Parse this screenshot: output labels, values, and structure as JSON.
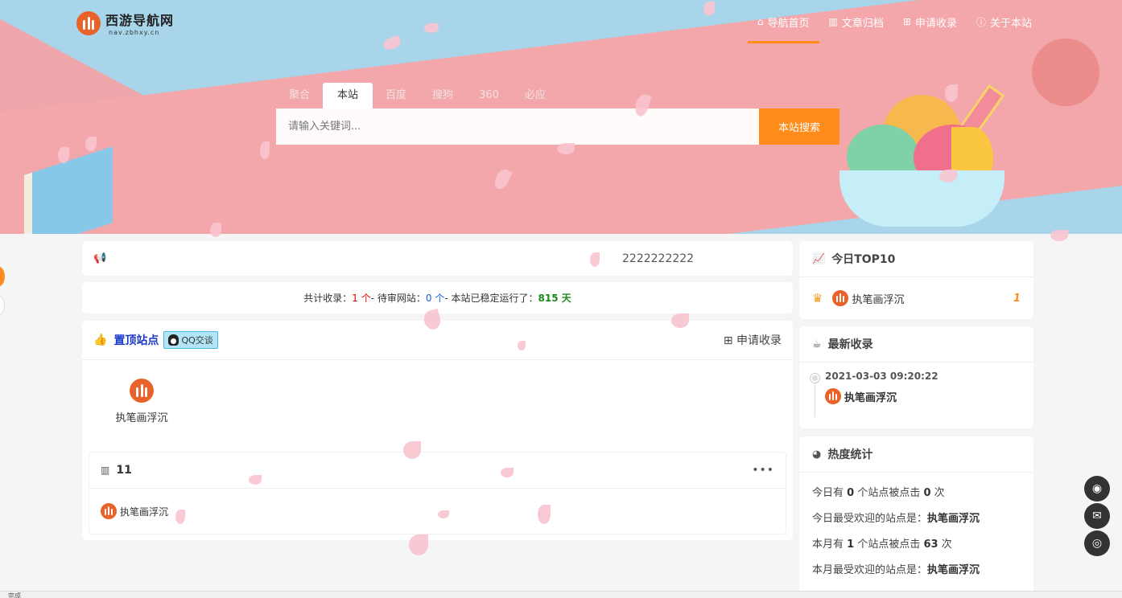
{
  "brand": {
    "name": "西游导航网",
    "url": "nav.zbhxy.cn"
  },
  "nav": [
    {
      "icon": "home-icon",
      "glyph": "⌂",
      "label": "导航首页",
      "active": true
    },
    {
      "icon": "bar-chart-icon",
      "glyph": "▥",
      "label": "文章归档"
    },
    {
      "icon": "plus-square-icon",
      "glyph": "⊞",
      "label": "申请收录"
    },
    {
      "icon": "info-icon",
      "glyph": "ⓘ",
      "label": "关于本站"
    }
  ],
  "search": {
    "tabs": [
      "聚合",
      "本站",
      "百度",
      "搜狗",
      "360",
      "必应"
    ],
    "active_tab": "本站",
    "placeholder": "请输入关键词...",
    "button": "本站搜索"
  },
  "notice": {
    "text": "2222222222"
  },
  "stats": {
    "label1": "共计收录：",
    "total": "1 个",
    "sep1": " - 待审网站：",
    "pending": "0 个",
    "sep2": " - 本站已稳定运行了：",
    "days": "815 天"
  },
  "top_sites": {
    "title": "置顶站点",
    "qq_label": "QQ交谈",
    "apply_label": "申请收录",
    "items": [
      {
        "label": "执笔画浮沉"
      }
    ]
  },
  "category": {
    "count": "11",
    "more": "•••",
    "items": [
      {
        "label": "执笔画浮沉"
      }
    ]
  },
  "top10": {
    "title": "今日TOP10",
    "items": [
      {
        "label": "执笔画浮沉",
        "rank": "1"
      }
    ]
  },
  "latest": {
    "title": "最新收录",
    "items": [
      {
        "date": "2021-03-03 09:20:22",
        "label": "执笔画浮沉"
      }
    ]
  },
  "heat": {
    "title": "热度统计",
    "today_a": "今日有 ",
    "today_sites": "0",
    "today_b": " 个站点被点击 ",
    "today_clicks": "0",
    "today_c": " 次",
    "today_pop_label": "今日最受欢迎的站点是：",
    "today_pop": "执笔画浮沉",
    "month_a": "本月有 ",
    "month_sites": "1",
    "month_b": " 个站点被点击 ",
    "month_clicks": "63",
    "month_c": " 次",
    "month_pop_label": "本月最受欢迎的站点是：",
    "month_pop": "执笔画浮沉"
  },
  "status_bar": {
    "text": "完成"
  }
}
